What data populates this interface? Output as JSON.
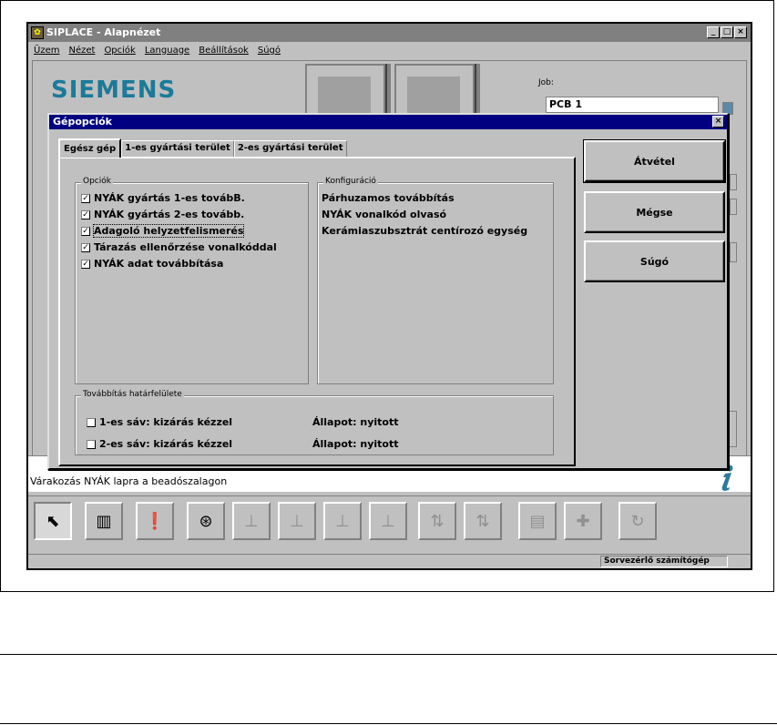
{
  "window": {
    "title": "SIPLACE - Alapnézet",
    "min_label": "_",
    "max_label": "□",
    "close_label": "×"
  },
  "menu": {
    "items": [
      "Üzem",
      "Nézet",
      "Opciók",
      "Language",
      "Beállítások",
      "Súgó"
    ]
  },
  "brand": "SIEMENS",
  "job": {
    "label": "Job:",
    "value": "PCB 1"
  },
  "dialog": {
    "title": "Gépopciók",
    "close_label": "×",
    "tabs": [
      "Egész gép",
      "1-es gyártási terület",
      "2-es gyártási terület"
    ],
    "options_group": {
      "legend": "Opciók",
      "items": [
        {
          "label": "NYÁK gyártás 1-es továbB.",
          "checked": true
        },
        {
          "label": "NYÁK gyártás 2-es tovább.",
          "checked": true
        },
        {
          "label": "Adagoló helyzetfelismerés",
          "checked": true
        },
        {
          "label": "Tárazás ellenőrzése vonalkóddal",
          "checked": true
        },
        {
          "label": "NYÁK adat továbbítása",
          "checked": true
        }
      ]
    },
    "config_group": {
      "legend": "Konfiguráció",
      "items": [
        "Párhuzamos továbbítás",
        "NYÁK vonalkód olvasó",
        "Kerámiaszubsztrát centírozó egység"
      ]
    },
    "interface_group": {
      "legend": "Továbbítás határfelülete",
      "rows": [
        {
          "label": "1-es sáv: kizárás kézzel",
          "checked": false,
          "status": "Állapot: nyitott"
        },
        {
          "label": "2-es sáv: kizárás kézzel",
          "checked": false,
          "status": "Állapot: nyitott"
        }
      ]
    },
    "buttons": {
      "accept": "Átvétel",
      "cancel": "Mégse",
      "help": "Súgó"
    }
  },
  "message": "Várakozás NYÁK lapra a beadószalagon",
  "status": {
    "host": "Sorvezérlő számítógép"
  },
  "toolbar_icons": [
    "select-pointer-icon",
    "feeder-table-icon",
    "alert-icon",
    "reel-icon",
    "head-1-icon",
    "head-2-icon",
    "head-3-icon",
    "head-4-icon",
    "conveyor-2-icon",
    "conveyor-1-icon",
    "calculator-icon",
    "component-icon",
    "refresh-icon"
  ]
}
